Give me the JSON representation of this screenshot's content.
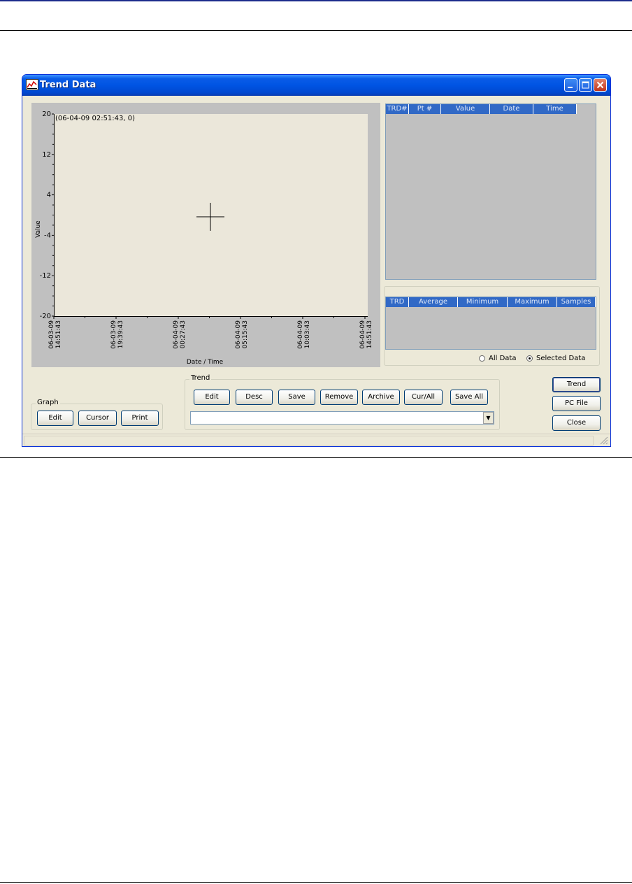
{
  "window": {
    "title": "Trend Data",
    "title_icon": "trend-chart-icon",
    "controls": [
      "minimize-icon",
      "maximize-icon",
      "close-icon"
    ]
  },
  "chart": {
    "annotation": "(06-04-09 02:51:43, 0)",
    "ylabel": "Value",
    "xlabel": "Date / Time",
    "y_ticks": [
      "20",
      "12",
      "4",
      "-4",
      "-12",
      "-20"
    ],
    "x_ticks": [
      [
        "06-03-09",
        "14:51:43"
      ],
      [
        "06-03-09",
        "19:39:43"
      ],
      [
        "06-04-09",
        "00:27:43"
      ],
      [
        "06-04-09",
        "05:15:43"
      ],
      [
        "06-04-09",
        "10:03:43"
      ],
      [
        "06-04-09",
        "14:51:43"
      ]
    ],
    "colors": {
      "plot_bg": "#ebe7da",
      "panel_bg": "#c0c0c0"
    }
  },
  "points_table": {
    "columns": [
      "TRD#",
      "Pt #",
      "Value",
      "Date",
      "Time"
    ]
  },
  "stats_table": {
    "columns": [
      "TRD",
      "Average",
      "Minimum",
      "Maximum",
      "Samples"
    ]
  },
  "radio": {
    "all_label": "All Data",
    "selected_label": "Selected Data",
    "selected": "Selected Data"
  },
  "graph_group": {
    "label": "Graph",
    "buttons": [
      "Edit",
      "Cursor",
      "Print"
    ]
  },
  "trend_group": {
    "label": "Trend",
    "buttons": [
      "Edit",
      "Desc",
      "Save",
      "Remove",
      "Archive",
      "Cur/All",
      "Save All"
    ],
    "select_value": ""
  },
  "side_buttons": [
    "Trend",
    "PC File",
    "Close"
  ],
  "colors": {
    "header_blue": "#3169c6",
    "titlebar": "#0054e3"
  }
}
